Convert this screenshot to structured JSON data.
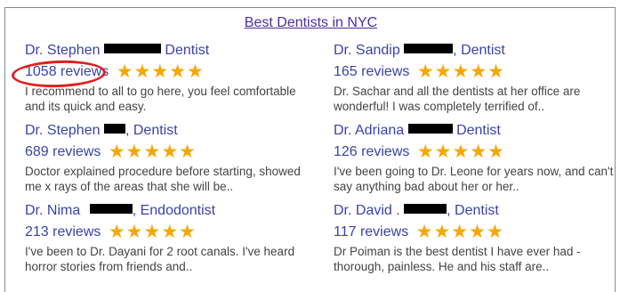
{
  "header": {
    "title": "Best Dentists in NYC"
  },
  "star_color": "#f7a600",
  "annotation_color": "#e02020",
  "star_glyph": "★",
  "dentists": [
    {
      "name": "Dr. Stephen",
      "sep": " ",
      "specialty": "Dentist",
      "reviews": "1058 reviews",
      "stars": 5,
      "snippet": "I recommend to all to go here, you feel comfortable and its quick and easy."
    },
    {
      "name": "Dr. Sandip",
      "sep": ",",
      "specialty": "Dentist",
      "reviews": "165 reviews",
      "stars": 5,
      "snippet": "Dr. Sachar and all the dentists at her office are wonderful! I was completely terrified of.."
    },
    {
      "name": "Dr. Stephen",
      "sep": ",",
      "specialty": "Dentist",
      "reviews": "689 reviews",
      "stars": 5,
      "snippet": "Doctor explained procedure before starting, showed me x rays of the areas that she will be.."
    },
    {
      "name": "Dr. Adriana",
      "sep": " ",
      "specialty": "Dentist",
      "reviews": "126 reviews",
      "stars": 5,
      "snippet": "I've been going to Dr. Leone for years now, and can't say anything bad about her or her.."
    },
    {
      "name": "Dr. Nima",
      "sep": ",",
      "specialty": "Endodontist",
      "reviews": "213 reviews",
      "stars": 5,
      "snippet": "I've been to Dr. Dayani for 2 root canals. I've heard horror stories from friends and.."
    },
    {
      "name": "Dr. David .",
      "sep": ",",
      "specialty": "Dentist",
      "reviews": "117 reviews",
      "stars": 5,
      "snippet": "Dr Poiman is the best dentist I have ever had - thorough, painless. He and his staff are.."
    }
  ]
}
